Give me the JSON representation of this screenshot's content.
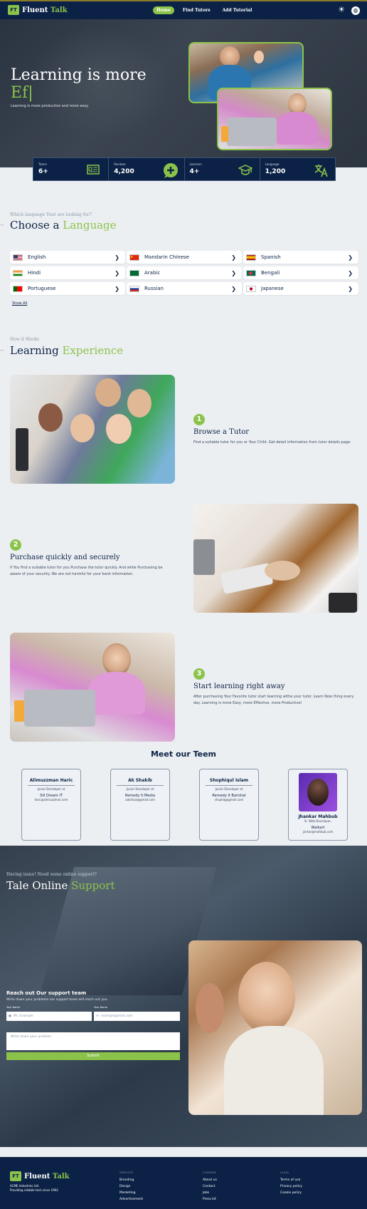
{
  "nav": {
    "logo_fluent": "Fluent",
    "logo_talk": "Talk",
    "logo_mark": "FT",
    "links": [
      "Home",
      "Find Tutors",
      "Add Tutorial"
    ],
    "icons": [
      "theme-sun-icon",
      "globe-icon"
    ]
  },
  "hero": {
    "title_line1": "Learning is more",
    "title_line2": "Ef|",
    "subtitle": "Learning is more productive and more easy."
  },
  "stats": [
    {
      "label": "Tutors",
      "value": "6+",
      "icon": "card-icon"
    },
    {
      "label": "Reviews",
      "value": "4,200",
      "icon": "plus-chat-icon"
    },
    {
      "label": "Learners",
      "value": "4+",
      "icon": "graduation-cap-icon"
    },
    {
      "label": "Language",
      "value": "1,200",
      "icon": "translate-icon"
    }
  ],
  "languages_section": {
    "eyebrow": "Which language Your are looking for?",
    "title": "Choose a",
    "title_accent": "Language",
    "items": [
      {
        "name": "English",
        "flag": "us"
      },
      {
        "name": "Mandarin Chinese",
        "flag": "cn"
      },
      {
        "name": "Spanish",
        "flag": "es"
      },
      {
        "name": "Hindi",
        "flag": "in"
      },
      {
        "name": "Arabic",
        "flag": "sa"
      },
      {
        "name": "Bengali",
        "flag": "bd"
      },
      {
        "name": "Portuguese",
        "flag": "pt"
      },
      {
        "name": "Russian",
        "flag": "ru"
      },
      {
        "name": "Japanese",
        "flag": "jp"
      }
    ],
    "show_all": "Show All"
  },
  "how_section": {
    "eyebrow": "How it Works",
    "title": "Learning",
    "title_accent": "Experience",
    "steps": [
      {
        "num": "1",
        "title": "Browse a Tutor",
        "desc": "Find a suitable tutor for you or Your Child. Get detail information from tutor details page."
      },
      {
        "num": "2",
        "title": "Purchase quickly and securely",
        "desc": "If You find a suitable tutor for you Purchase the tutor quickly. And while Purchasing be aware of your security. We are not harmful for your bank information."
      },
      {
        "num": "3",
        "title": "Start learning right away",
        "desc": "After purchasing Your Favorite tutor start learning withe your tutor. Learn Now thing every day. Learning is more Easy, more Effective, more Productive!"
      }
    ]
  },
  "team": {
    "title": "Meet our Teem",
    "members": [
      {
        "name": "Alimuzzman Haric",
        "role": "Junior Developer at",
        "company": "Sill Dream IT",
        "email": "harc@alimuzzman.com"
      },
      {
        "name": "Ak Shakib",
        "role": "Junior Developer at",
        "company": "Remedy It Media",
        "email": "aaksfuai@gmail.com"
      },
      {
        "name": "Shophiqul Islam",
        "role": "Junior Developer at",
        "company": "Remedy It Barishal",
        "email": "shophiq@gmail.com"
      },
      {
        "name": "Jhankar Mahbub",
        "role": "Sr. Web Developer,",
        "company": "Walkart",
        "email": "jonkar@mahbub.com"
      }
    ]
  },
  "support": {
    "eyebrow": "Having issue! Need some online support?",
    "title": "Tale Online",
    "title_accent": "Support",
    "form_title": "Reach out Our support team",
    "form_sub": "Write down your problems our support team will reach out you.",
    "label_name": "Your Name",
    "label_email": "Your Name",
    "name_placeholder": "Mr. Example",
    "email_placeholder": "example@mail.com",
    "message_placeholder": "Write down your problem",
    "submit_label": "Submit"
  },
  "footer": {
    "logo_fluent": "Fluent",
    "logo_talk": "Talk",
    "tag1": "ACME Industries Ltd.",
    "tag2": "Providing reliable tech since 1992",
    "columns": [
      {
        "heading": "SERVICES",
        "items": [
          "Branding",
          "Design",
          "Marketing",
          "Advertisement"
        ]
      },
      {
        "heading": "COMPANY",
        "items": [
          "About us",
          "Contact",
          "Jobs",
          "Press kit"
        ]
      },
      {
        "heading": "LEGAL",
        "items": [
          "Terms of use",
          "Privacy policy",
          "Cookie policy"
        ]
      }
    ]
  }
}
